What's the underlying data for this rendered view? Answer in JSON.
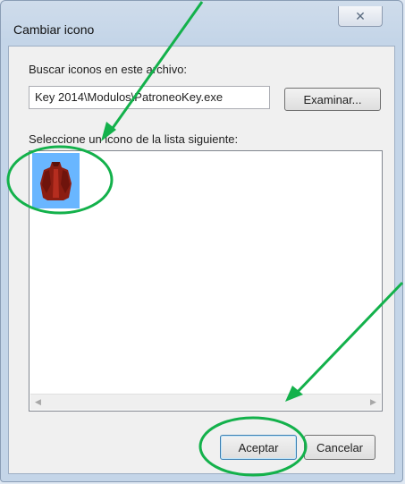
{
  "window": {
    "title": "Cambiar icono",
    "close_symbol": "✕"
  },
  "dialog": {
    "search_label": "Buscar iconos en este archivo:",
    "file_path": "Key 2014\\Modulos\\PatroneoKey.exe",
    "browse_label": "Examinar...",
    "list_label": "Seleccione un icono de la lista siguiente:",
    "icons": [
      {
        "name": "red-jacket-icon",
        "selected": true
      }
    ],
    "ok_label": "Aceptar",
    "cancel_label": "Cancelar"
  },
  "annotations": {
    "color": "#13b14b"
  }
}
